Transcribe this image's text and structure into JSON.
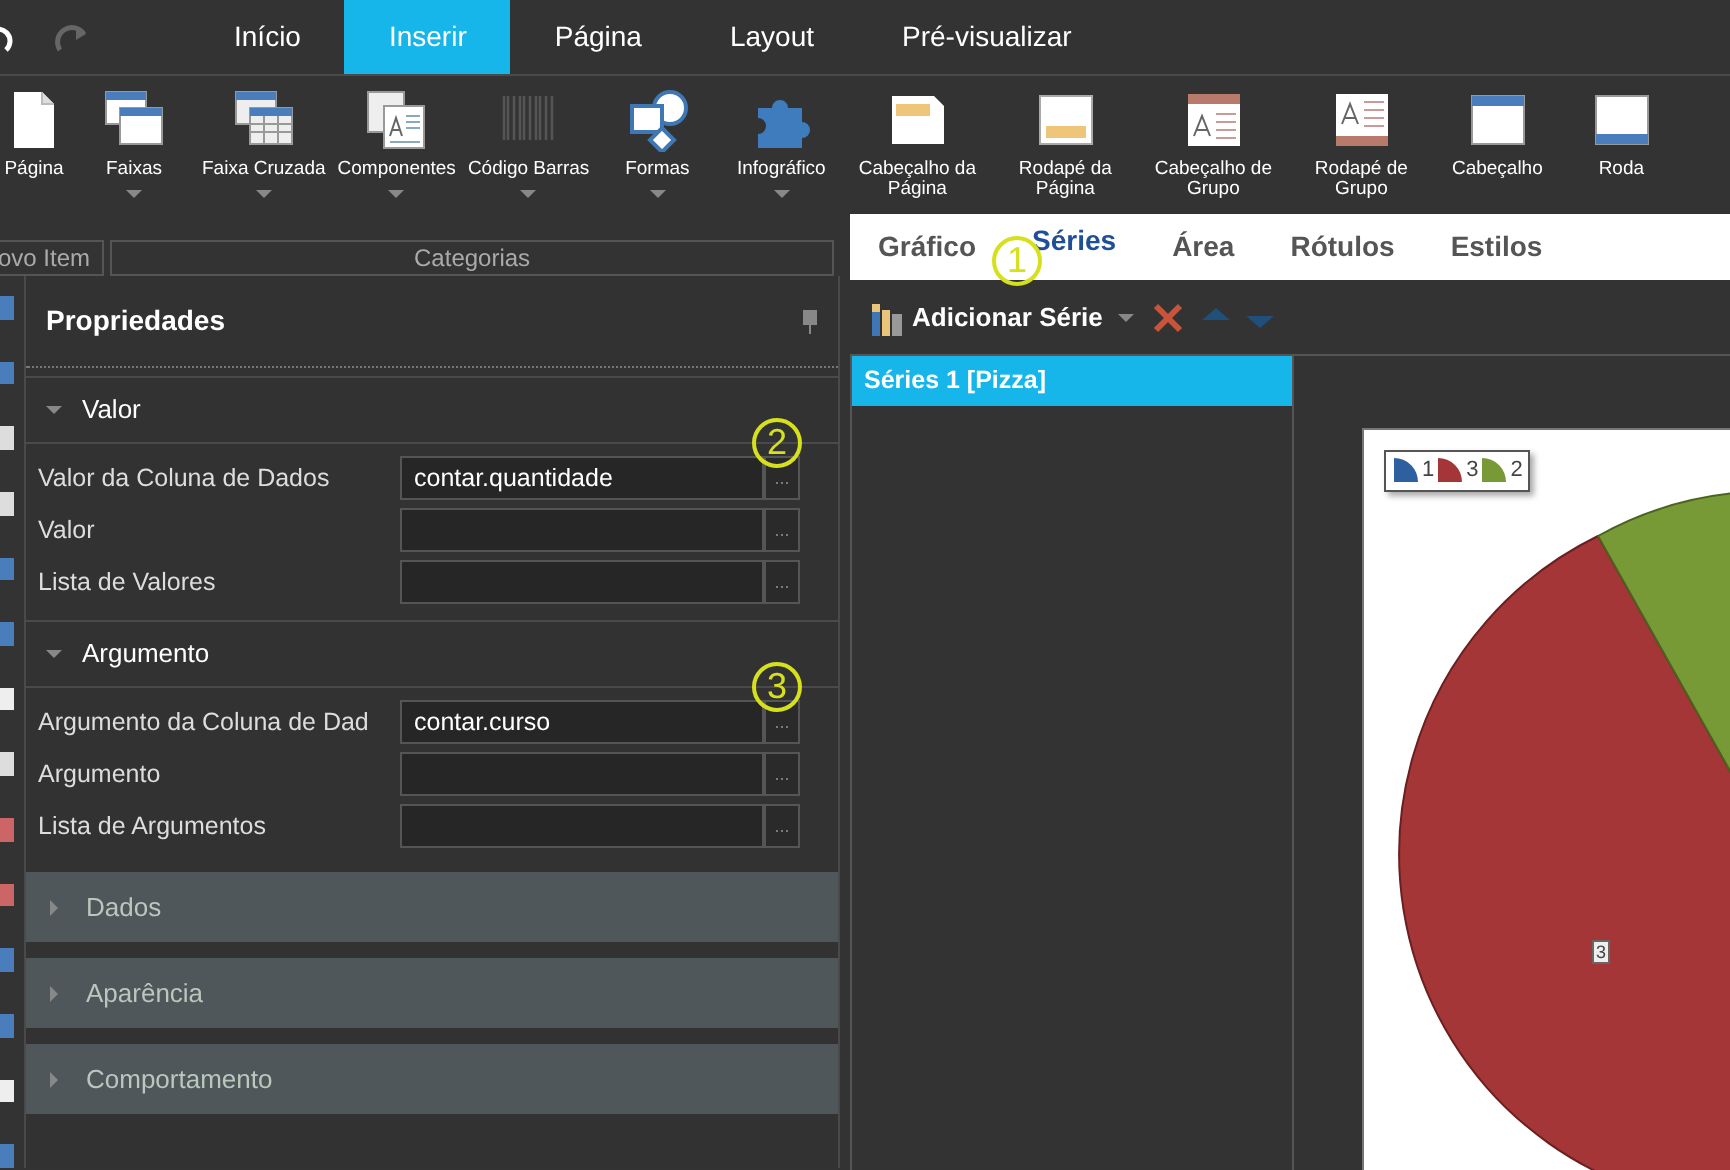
{
  "menu_tabs": [
    {
      "label": "Início",
      "selected": false
    },
    {
      "label": "Inserir",
      "selected": true
    },
    {
      "label": "Página",
      "selected": false
    },
    {
      "label": "Layout",
      "selected": false
    },
    {
      "label": "Pré-visualizar",
      "selected": false
    }
  ],
  "ribbon": {
    "items": [
      {
        "kind": "page",
        "label": "Página",
        "dropdown": false
      },
      {
        "kind": "bands",
        "label": "Faixas",
        "dropdown": true
      },
      {
        "kind": "cross-band",
        "label": "Faixa Cruzada",
        "dropdown": true
      },
      {
        "kind": "components",
        "label": "Componentes",
        "dropdown": true
      },
      {
        "kind": "barcode",
        "label": "Código Barras",
        "dropdown": true
      },
      {
        "kind": "shapes",
        "label": "Formas",
        "dropdown": true
      },
      {
        "kind": "infographic",
        "label": "Infográfico",
        "dropdown": true
      },
      {
        "kind": "page-header",
        "label": "Cabeçalho da Página",
        "dropdown": false
      },
      {
        "kind": "page-footer",
        "label": "Rodapé da Página",
        "dropdown": false
      },
      {
        "kind": "group-header",
        "label": "Cabeçalho de Grupo",
        "dropdown": false
      },
      {
        "kind": "group-footer",
        "label": "Rodapé de Grupo",
        "dropdown": false
      },
      {
        "kind": "header",
        "label": "Cabeçalho",
        "dropdown": false
      },
      {
        "kind": "footer",
        "label": "Roda",
        "dropdown": false
      }
    ],
    "groups": [
      "ovo Item",
      "Categorias"
    ]
  },
  "properties": {
    "title": "Propriedades",
    "sections": [
      {
        "title": "Valor",
        "expanded": true,
        "annotation": "2",
        "rows": [
          {
            "label": "Valor da Coluna de Dados",
            "value": "contar.quantidade",
            "button": "..."
          },
          {
            "label": "Valor",
            "button": "..."
          },
          {
            "label": "Lista de Valores",
            "button": "..."
          }
        ]
      },
      {
        "title": "Argumento",
        "expanded": true,
        "annotation": "3",
        "rows": [
          {
            "label": "Argumento da Coluna de Dad",
            "value": "contar.curso",
            "button": "..."
          },
          {
            "label": "Argumento",
            "button": "..."
          },
          {
            "label": "Lista de Argumentos",
            "button": "..."
          }
        ]
      },
      {
        "title": "Dados",
        "expanded": false
      },
      {
        "title": "Aparência",
        "expanded": false
      },
      {
        "title": "Comportamento",
        "expanded": false
      }
    ]
  },
  "designer": {
    "tabs": [
      {
        "label": "Gráfico",
        "selected": false
      },
      {
        "label": "Séries",
        "selected": true,
        "annotation": "1"
      },
      {
        "label": "Área",
        "selected": false
      },
      {
        "label": "Rótulos",
        "selected": false
      },
      {
        "label": "Estilos",
        "selected": false
      }
    ],
    "add_series": "Adicionar Série",
    "series": [
      {
        "label": "Séries 1 [Pizza]",
        "selected": true
      }
    ],
    "chart": {
      "legend": [
        {
          "label": "1",
          "color": "#2e5f9f"
        },
        {
          "label": "3",
          "color": "#a53638"
        },
        {
          "label": "2",
          "color": "#779a36"
        }
      ],
      "slice_label": "3"
    }
  }
}
